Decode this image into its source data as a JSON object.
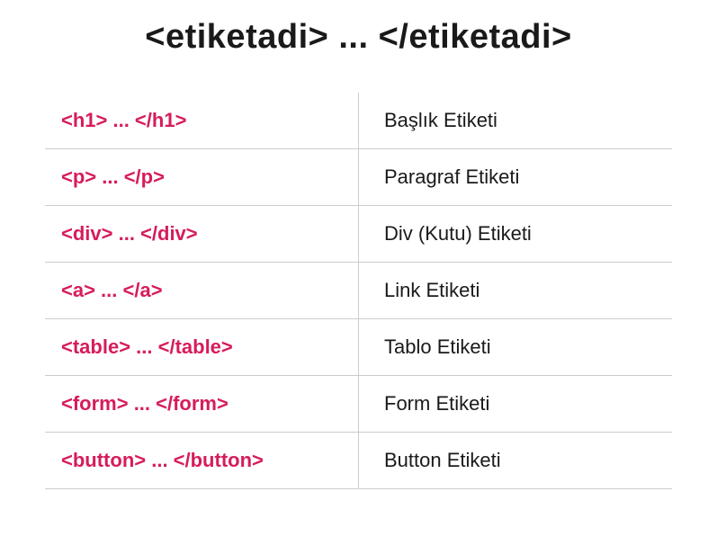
{
  "heading": "<etiketadi>  ... </etiketadi>",
  "rows": [
    {
      "tag": "<h1> ... </h1>",
      "desc": "Başlık Etiketi"
    },
    {
      "tag": "<p> ... </p>",
      "desc": "Paragraf Etiketi"
    },
    {
      "tag": "<div> ... </div>",
      "desc": "Div (Kutu) Etiketi"
    },
    {
      "tag": "<a> ... </a>",
      "desc": "Link Etiketi"
    },
    {
      "tag": "<table> ... </table>",
      "desc": "Tablo Etiketi"
    },
    {
      "tag": "<form> ... </form>",
      "desc": "Form Etiketi"
    },
    {
      "tag": "<button> ... </button>",
      "desc": "Button Etiketi"
    }
  ]
}
